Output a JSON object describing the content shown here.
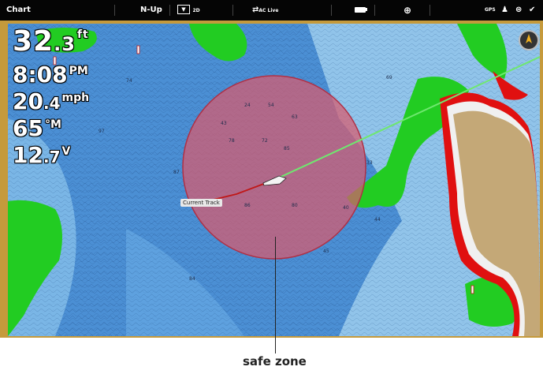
{
  "topbar": {
    "title": "Chart",
    "orientation": "N-Up",
    "view_mode": "2D",
    "ac_label": "AC Live",
    "gps_label": "GPS"
  },
  "readouts": {
    "depth_value": "32",
    "depth_decimal": ".3",
    "depth_unit": "ft",
    "time_value": "8:08",
    "time_unit": "PM",
    "speed_value": "20",
    "speed_decimal": ".4",
    "speed_unit": "mph",
    "temp_value": "65",
    "temp_unit": "°M",
    "voltage_value": "12",
    "voltage_decimal": ".7",
    "voltage_unit": "V"
  },
  "map": {
    "track_label": "Current Track",
    "safe_zone_color": "#d85a6e",
    "land_color": "#c4a877",
    "shallow_color": "#2ecc2e",
    "danger_color": "#e01010",
    "depth_labels": [
      "74",
      "24",
      "54",
      "43",
      "97",
      "78",
      "72",
      "85",
      "87",
      "86",
      "80",
      "33",
      "45",
      "44",
      "40",
      "69",
      "63",
      "57"
    ]
  },
  "caption": "safe zone"
}
